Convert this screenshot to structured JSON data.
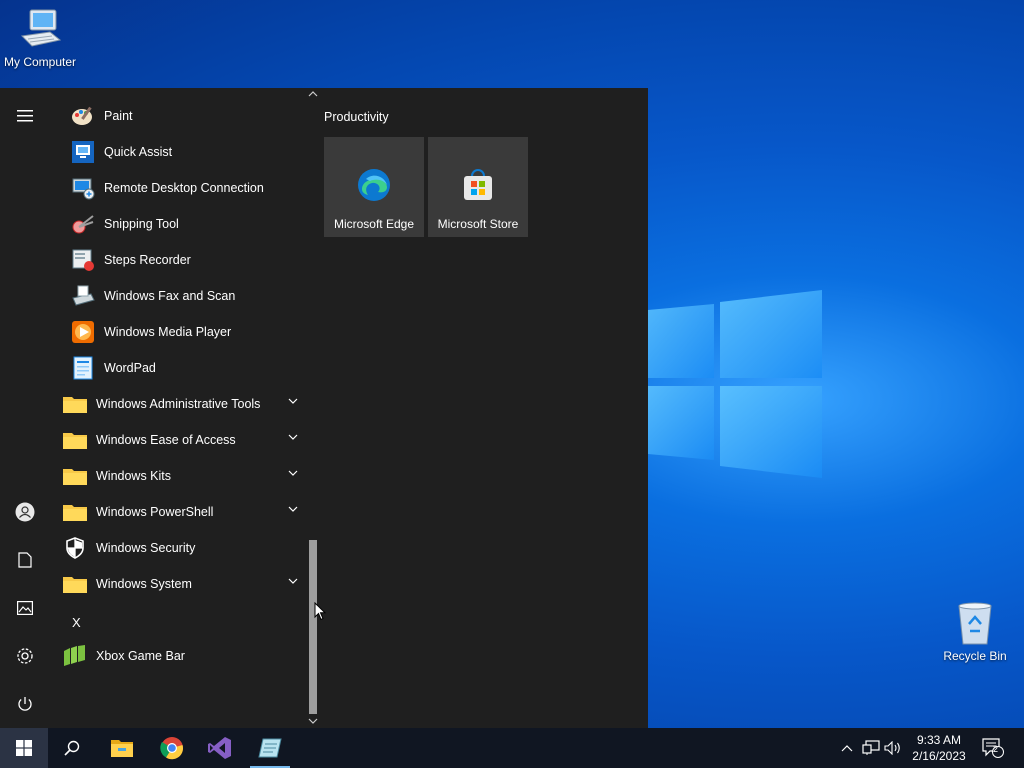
{
  "desktop": {
    "icons": [
      {
        "label": "My Computer",
        "icon": "computer-icon"
      },
      {
        "label": "Recycle Bin",
        "icon": "recycle-bin-icon"
      }
    ]
  },
  "start_menu": {
    "rail": [
      "hamburger-menu-icon",
      "user-icon",
      "documents-icon",
      "pictures-icon",
      "settings-icon",
      "power-icon"
    ],
    "apps": [
      {
        "label": "Paint",
        "icon": "paint-icon"
      },
      {
        "label": "Quick Assist",
        "icon": "quick-assist-icon"
      },
      {
        "label": "Remote Desktop Connection",
        "icon": "remote-desktop-icon"
      },
      {
        "label": "Snipping Tool",
        "icon": "snipping-tool-icon"
      },
      {
        "label": "Steps Recorder",
        "icon": "steps-recorder-icon"
      },
      {
        "label": "Windows Fax and Scan",
        "icon": "fax-scan-icon"
      },
      {
        "label": "Windows Media Player",
        "icon": "media-player-icon"
      },
      {
        "label": "WordPad",
        "icon": "wordpad-icon"
      },
      {
        "label": "Windows Administrative Tools",
        "icon": "folder-icon"
      },
      {
        "label": "Windows Ease of Access",
        "icon": "folder-icon"
      },
      {
        "label": "Windows Kits",
        "icon": "folder-icon"
      },
      {
        "label": "Windows PowerShell",
        "icon": "folder-icon"
      },
      {
        "label": "Windows Security",
        "icon": "shield-icon"
      },
      {
        "label": "Windows System",
        "icon": "folder-icon"
      },
      {
        "label": "Xbox Game Bar",
        "icon": "xbox-game-bar-icon"
      }
    ],
    "section_letter": "X",
    "tile_group": {
      "title": "Productivity",
      "tiles": [
        {
          "label": "Microsoft Edge",
          "icon": "edge-icon"
        },
        {
          "label": "Microsoft Store",
          "icon": "store-icon"
        }
      ]
    }
  },
  "taskbar": {
    "pinned": [
      "windows-start-icon",
      "search-icon",
      "file-explorer-icon",
      "chrome-icon",
      "visual-studio-icon",
      "notepad-app-icon"
    ],
    "clock": {
      "time": "9:33 AM",
      "date": "2/16/2023"
    },
    "notification_count": "2"
  },
  "colors": {
    "menu_bg": "#1f1f1f",
    "tile_bg": "#3a3a3a",
    "taskbar_bg": "#101622",
    "accent": "#76b9ed"
  }
}
